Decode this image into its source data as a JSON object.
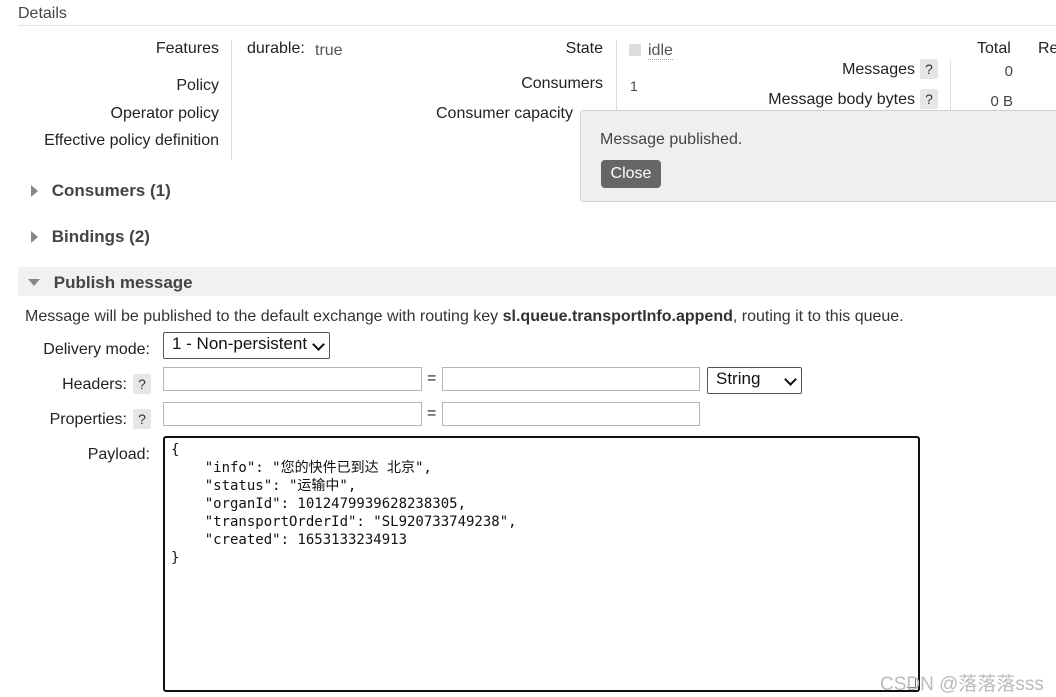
{
  "details": {
    "heading": "Details",
    "features_label": "Features",
    "durable_key": "durable:",
    "durable_value": "true",
    "policy_label": "Policy",
    "operator_policy_label": "Operator policy",
    "effective_policy_label": "Effective policy definition",
    "state_label": "State",
    "state_value": "idle",
    "consumers_label": "Consumers",
    "consumers_value": "1",
    "consumer_capacity_label": "Consumer capacity",
    "total_header": "Total",
    "re_header": "Re",
    "messages_label": "Messages",
    "messages_value": "0",
    "message_body_bytes_label": "Message body bytes",
    "message_body_bytes_value": "0 B",
    "help_mark": "?"
  },
  "sections": {
    "consumers": "Consumers (1)",
    "bindings": "Bindings (2)",
    "publish": "Publish message"
  },
  "publish": {
    "intro_before": "Message will be published to the default exchange with routing key ",
    "routing_key": "sl.queue.transportInfo.append",
    "intro_after": ", routing it to this queue.",
    "delivery_mode_label": "Delivery mode:",
    "delivery_mode_value": "1 - Non-persistent",
    "headers_label": "Headers:",
    "properties_label": "Properties:",
    "equals": "=",
    "header_type_value": "String",
    "payload_label": "Payload:",
    "payload_lines": [
      "{",
      "    \"info\": \"您的快件已到达 北京\",",
      "    \"status\": \"运输中\",",
      "    \"organId\": 1012479939628238305,",
      "    \"transportOrderId\": \"SL920733749238\",",
      "    \"created\": 1653133234913",
      "}"
    ]
  },
  "popup": {
    "message": "Message published.",
    "close_label": "Close"
  },
  "watermark": "CSDN @落落落sss",
  "colors": {
    "popup_bg": "#efefef",
    "close_button": "#666666",
    "help_bg": "#e6e6e6"
  }
}
